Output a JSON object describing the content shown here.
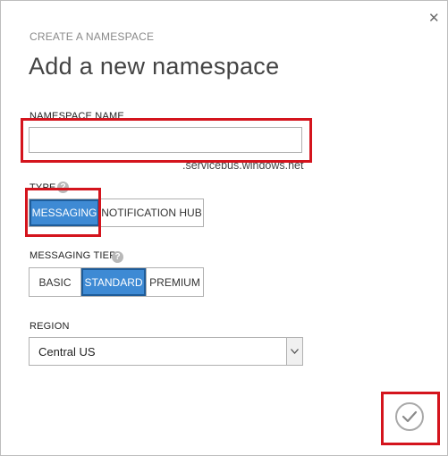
{
  "dialog": {
    "close_icon": "close-icon",
    "subtitle": "CREATE A NAMESPACE",
    "title": "Add a new namespace"
  },
  "namespace_name": {
    "label": "NAMESPACE NAME",
    "value": "",
    "placeholder": "",
    "suffix": ".servicebus.windows.net"
  },
  "type": {
    "label": "TYPE",
    "help_icon": "help-icon",
    "options": [
      "MESSAGING",
      "NOTIFICATION HUB"
    ],
    "selected": "MESSAGING"
  },
  "messaging_tier": {
    "label": "MESSAGING TIER",
    "help_icon": "help-icon",
    "options": [
      "BASIC",
      "STANDARD",
      "PREMIUM"
    ],
    "selected": "STANDARD"
  },
  "region": {
    "label": "REGION",
    "selected": "Central US",
    "arrow_icon": "chevron-down-icon"
  },
  "confirm": {
    "icon": "checkmark-icon"
  },
  "colors": {
    "selected_bg": "#3e8ad4",
    "selected_border": "#1e5c99",
    "highlight": "#d4141d"
  }
}
